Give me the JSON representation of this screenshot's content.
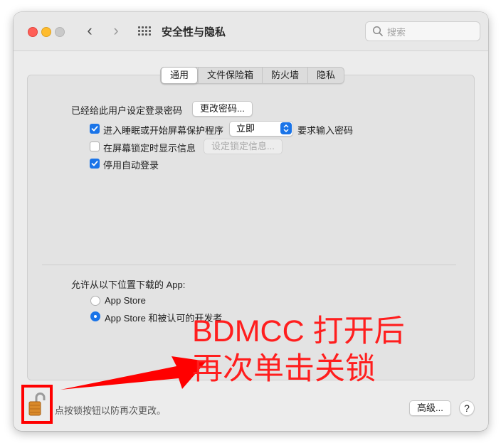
{
  "window": {
    "title": "安全性与隐私",
    "search_placeholder": "搜索"
  },
  "tabs": [
    {
      "label": "通用",
      "active": true
    },
    {
      "label": "文件保险箱",
      "active": false
    },
    {
      "label": "防火墙",
      "active": false
    },
    {
      "label": "隐私",
      "active": false
    }
  ],
  "general": {
    "password_set_label": "已经给此用户设定登录密码",
    "change_password_button": "更改密码...",
    "require_password": {
      "checked": true,
      "label_before": "进入睡眠或开始屏幕保护程序",
      "select_value": "立即",
      "label_after": "要求输入密码"
    },
    "show_message": {
      "checked": false,
      "label": "在屏幕锁定时显示信息",
      "button": "设定锁定信息..."
    },
    "disable_auto_login": {
      "checked": true,
      "label": "停用自动登录"
    },
    "allow_apps_label": "允许从以下位置下载的 App:",
    "app_sources": [
      {
        "label": "App Store",
        "selected": false
      },
      {
        "label": "App Store 和被认可的开发者",
        "selected": true
      }
    ]
  },
  "footer": {
    "lock_hint": "点按锁按钮以防再次更改。",
    "advanced_button": "高级...",
    "help_button": "?"
  },
  "annotation": {
    "line1": "BDMCC 打开后",
    "line2": "再次单击关锁",
    "color": "#ff1e1e"
  },
  "colors": {
    "accent": "#1a74e8",
    "annotation_red": "#ff0000"
  }
}
